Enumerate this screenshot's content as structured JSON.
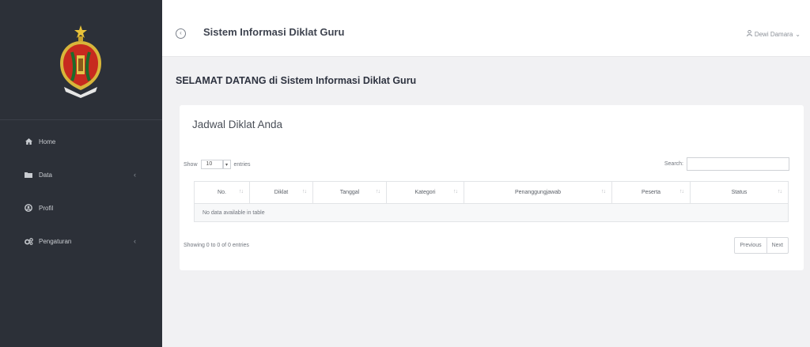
{
  "app": {
    "title": "Sistem Informasi Diklat Guru",
    "user": "Dewi Damara"
  },
  "sidebar": {
    "items": [
      {
        "label": "Home",
        "icon": "home-icon"
      },
      {
        "label": "Data",
        "icon": "folder-icon",
        "has_submenu": true
      },
      {
        "label": "Profil",
        "icon": "user-icon"
      },
      {
        "label": "Pengaturan",
        "icon": "gears-icon",
        "has_submenu": true
      }
    ]
  },
  "main": {
    "welcome": "SELAMAT DATANG di Sistem Informasi Diklat Guru",
    "card_title": "Jadwal Diklat Anda",
    "length": {
      "show": "Show",
      "value": "10",
      "entries": "entries"
    },
    "search": {
      "label": "Search:",
      "value": ""
    },
    "table": {
      "columns": [
        "No.",
        "Diklat",
        "Tanggal",
        "Kategori",
        "Penanggungjawab",
        "Peserta",
        "Status"
      ],
      "empty": "No data available in table"
    },
    "info": "Showing 0 to 0 of 0 entries",
    "pager": {
      "previous": "Previous",
      "next": "Next"
    }
  },
  "colors": {
    "sidebar_bg": "#2c3038",
    "page_bg": "#f1f1f3",
    "card_bg": "#ffffff"
  }
}
